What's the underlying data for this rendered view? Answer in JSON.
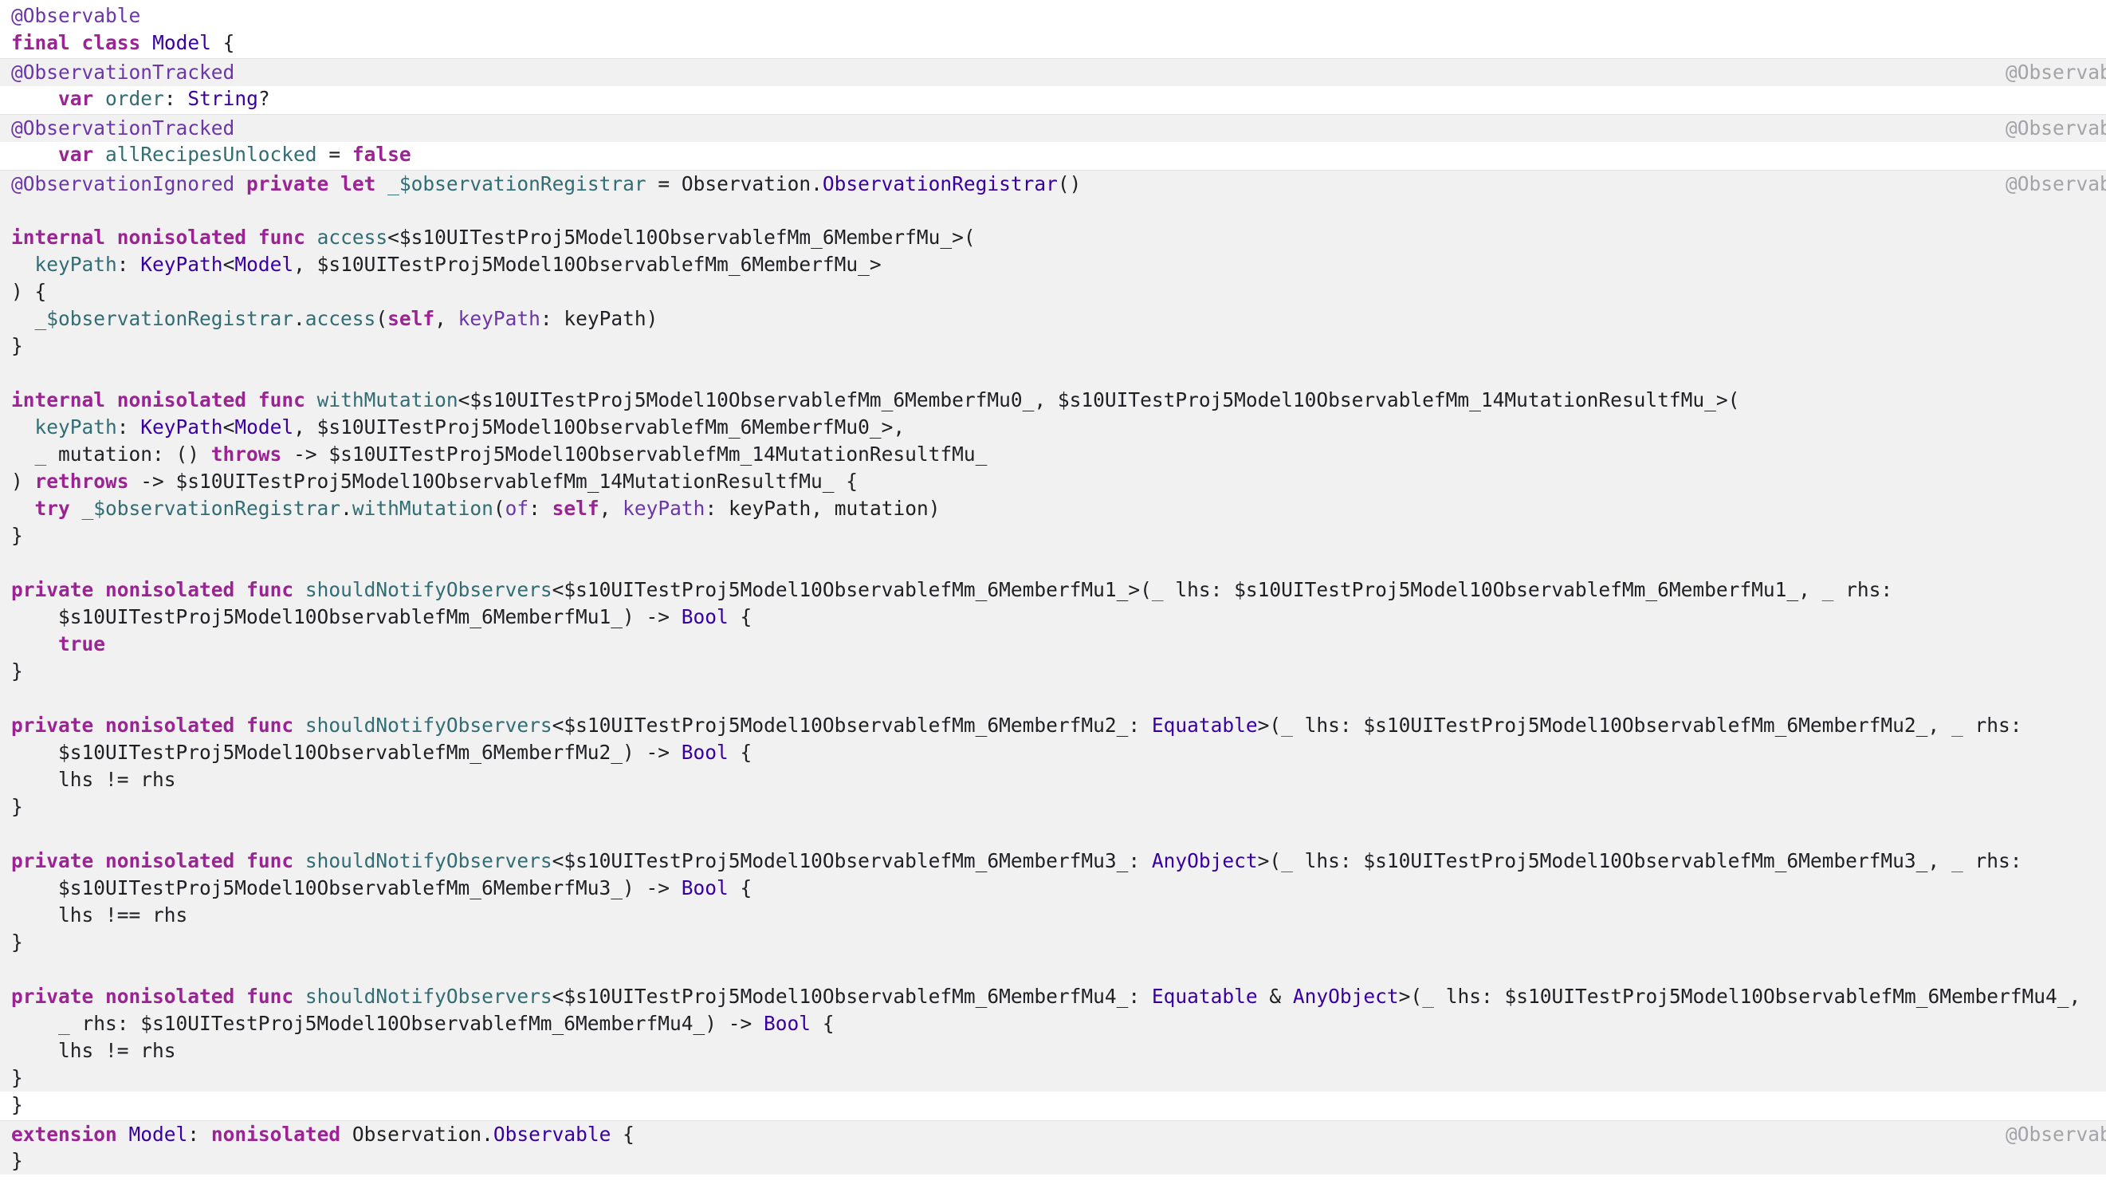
{
  "source_label": "@Observab",
  "colors": {
    "keyword": "#9b2393",
    "type": "#3900a0",
    "function": "#326d74",
    "attribute": "#6c36a9",
    "plain": "#1f1f24",
    "expansion_background": "#f1f1f1",
    "source_label": "#a3a3a8"
  },
  "lines": [
    {
      "kind": "source",
      "tokens": [
        [
          "@Observable",
          "macro"
        ]
      ]
    },
    {
      "kind": "source",
      "tokens": [
        [
          "final",
          "kw"
        ],
        [
          " ",
          ""
        ],
        [
          "class",
          "kw"
        ],
        [
          " ",
          ""
        ],
        [
          "Model",
          "ty"
        ],
        [
          " {",
          ""
        ]
      ]
    },
    {
      "kind": "expansion",
      "label": true,
      "tokens": [
        [
          "@ObservationTracked",
          "macro"
        ]
      ]
    },
    {
      "kind": "source",
      "tokens": [
        [
          "    ",
          ""
        ],
        [
          "var",
          "kw"
        ],
        [
          " ",
          ""
        ],
        [
          "order",
          "fn"
        ],
        [
          ": ",
          ""
        ],
        [
          "String",
          "ty"
        ],
        [
          "?",
          ""
        ]
      ]
    },
    {
      "kind": "expansion",
      "label": true,
      "tokens": [
        [
          "@ObservationTracked",
          "macro"
        ]
      ]
    },
    {
      "kind": "source",
      "tokens": [
        [
          "    ",
          ""
        ],
        [
          "var",
          "kw"
        ],
        [
          " ",
          ""
        ],
        [
          "allRecipesUnlocked",
          "fn"
        ],
        [
          " = ",
          ""
        ],
        [
          "false",
          "kw"
        ]
      ]
    },
    {
      "kind": "expansion",
      "label": true,
      "tokens": [
        [
          "@ObservationIgnored",
          "macro"
        ],
        [
          " ",
          ""
        ],
        [
          "private",
          "kw"
        ],
        [
          " ",
          ""
        ],
        [
          "let",
          "kw"
        ],
        [
          " ",
          ""
        ],
        [
          "_$observationRegistrar",
          "fn"
        ],
        [
          " = Observation.",
          ""
        ],
        [
          "ObservationRegistrar",
          "ty"
        ],
        [
          "()",
          ""
        ]
      ]
    },
    {
      "kind": "expansion",
      "tokens": []
    },
    {
      "kind": "expansion",
      "tokens": [
        [
          "internal",
          "kw"
        ],
        [
          " ",
          ""
        ],
        [
          "nonisolated",
          "kw"
        ],
        [
          " ",
          ""
        ],
        [
          "func",
          "kw"
        ],
        [
          " ",
          ""
        ],
        [
          "access",
          "fn"
        ],
        [
          "<$s10UITestProj5Model10ObservablefMm_6MemberfMu_>(",
          ""
        ]
      ]
    },
    {
      "kind": "expansion",
      "tokens": [
        [
          "  ",
          ""
        ],
        [
          "keyPath",
          "fn"
        ],
        [
          ": ",
          ""
        ],
        [
          "KeyPath",
          "ty"
        ],
        [
          "<",
          ""
        ],
        [
          "Model",
          "ty"
        ],
        [
          ", $s10UITestProj5Model10ObservablefMm_6MemberfMu_>",
          ""
        ]
      ]
    },
    {
      "kind": "expansion",
      "tokens": [
        [
          ") {",
          ""
        ]
      ]
    },
    {
      "kind": "expansion",
      "tokens": [
        [
          "  ",
          ""
        ],
        [
          "_$observationRegistrar",
          "fn"
        ],
        [
          ".",
          ""
        ],
        [
          "access",
          "fn"
        ],
        [
          "(",
          ""
        ],
        [
          "self",
          "kw"
        ],
        [
          ", ",
          ""
        ],
        [
          "keyPath",
          "pp"
        ],
        [
          ": keyPath)",
          ""
        ]
      ]
    },
    {
      "kind": "expansion",
      "tokens": [
        [
          "}",
          ""
        ]
      ]
    },
    {
      "kind": "expansion",
      "tokens": []
    },
    {
      "kind": "expansion",
      "tokens": [
        [
          "internal",
          "kw"
        ],
        [
          " ",
          ""
        ],
        [
          "nonisolated",
          "kw"
        ],
        [
          " ",
          ""
        ],
        [
          "func",
          "kw"
        ],
        [
          " ",
          ""
        ],
        [
          "withMutation",
          "fn"
        ],
        [
          "<$s10UITestProj5Model10ObservablefMm_6MemberfMu0_, $s10UITestProj5Model10ObservablefMm_14MutationResultfMu_>(",
          ""
        ]
      ]
    },
    {
      "kind": "expansion",
      "tokens": [
        [
          "  ",
          ""
        ],
        [
          "keyPath",
          "fn"
        ],
        [
          ": ",
          ""
        ],
        [
          "KeyPath",
          "ty"
        ],
        [
          "<",
          ""
        ],
        [
          "Model",
          "ty"
        ],
        [
          ", $s10UITestProj5Model10ObservablefMm_6MemberfMu0_>,",
          ""
        ]
      ]
    },
    {
      "kind": "expansion",
      "tokens": [
        [
          "  ",
          ""
        ],
        [
          "_",
          "fn"
        ],
        [
          " mutation: () ",
          ""
        ],
        [
          "throws",
          "kw"
        ],
        [
          " -> $s10UITestProj5Model10ObservablefMm_14MutationResultfMu_",
          ""
        ]
      ]
    },
    {
      "kind": "expansion",
      "tokens": [
        [
          ") ",
          ""
        ],
        [
          "rethrows",
          "kw"
        ],
        [
          " -> $s10UITestProj5Model10ObservablefMm_14MutationResultfMu_ {",
          ""
        ]
      ]
    },
    {
      "kind": "expansion",
      "tokens": [
        [
          "  ",
          ""
        ],
        [
          "try",
          "kw"
        ],
        [
          " ",
          ""
        ],
        [
          "_$observationRegistrar",
          "fn"
        ],
        [
          ".",
          ""
        ],
        [
          "withMutation",
          "fn"
        ],
        [
          "(",
          ""
        ],
        [
          "of",
          "pp"
        ],
        [
          ": ",
          ""
        ],
        [
          "self",
          "kw"
        ],
        [
          ", ",
          ""
        ],
        [
          "keyPath",
          "pp"
        ],
        [
          ": keyPath, mutation)",
          ""
        ]
      ]
    },
    {
      "kind": "expansion",
      "tokens": [
        [
          "}",
          ""
        ]
      ]
    },
    {
      "kind": "expansion",
      "tokens": []
    },
    {
      "kind": "expansion",
      "tokens": [
        [
          "private",
          "kw"
        ],
        [
          " ",
          ""
        ],
        [
          "nonisolated",
          "kw"
        ],
        [
          " ",
          ""
        ],
        [
          "func",
          "kw"
        ],
        [
          " ",
          ""
        ],
        [
          "shouldNotifyObservers",
          "fn"
        ],
        [
          "<$s10UITestProj5Model10ObservablefMm_6MemberfMu1_>(",
          ""
        ],
        [
          "_",
          "fn"
        ],
        [
          " lhs: $s10UITestProj5Model10ObservablefMm_6MemberfMu1_, ",
          ""
        ],
        [
          "_",
          "fn"
        ],
        [
          " rhs:",
          ""
        ]
      ]
    },
    {
      "kind": "expansion",
      "tokens": [
        [
          "    $s10UITestProj5Model10ObservablefMm_6MemberfMu1_) -> ",
          ""
        ],
        [
          "Bool",
          "ty"
        ],
        [
          " {",
          ""
        ]
      ]
    },
    {
      "kind": "expansion",
      "tokens": [
        [
          "    ",
          ""
        ],
        [
          "true",
          "kw"
        ]
      ]
    },
    {
      "kind": "expansion",
      "tokens": [
        [
          "}",
          ""
        ]
      ]
    },
    {
      "kind": "expansion",
      "tokens": []
    },
    {
      "kind": "expansion",
      "tokens": [
        [
          "private",
          "kw"
        ],
        [
          " ",
          ""
        ],
        [
          "nonisolated",
          "kw"
        ],
        [
          " ",
          ""
        ],
        [
          "func",
          "kw"
        ],
        [
          " ",
          ""
        ],
        [
          "shouldNotifyObservers",
          "fn"
        ],
        [
          "<$s10UITestProj5Model10ObservablefMm_6MemberfMu2_: ",
          ""
        ],
        [
          "Equatable",
          "ty"
        ],
        [
          ">(",
          ""
        ],
        [
          "_",
          "fn"
        ],
        [
          " lhs: $s10UITestProj5Model10ObservablefMm_6MemberfMu2_, ",
          ""
        ],
        [
          "_",
          "fn"
        ],
        [
          " rhs:",
          ""
        ]
      ]
    },
    {
      "kind": "expansion",
      "tokens": [
        [
          "    $s10UITestProj5Model10ObservablefMm_6MemberfMu2_) -> ",
          ""
        ],
        [
          "Bool",
          "ty"
        ],
        [
          " {",
          ""
        ]
      ]
    },
    {
      "kind": "expansion",
      "tokens": [
        [
          "    lhs != rhs",
          ""
        ]
      ]
    },
    {
      "kind": "expansion",
      "tokens": [
        [
          "}",
          ""
        ]
      ]
    },
    {
      "kind": "expansion",
      "tokens": []
    },
    {
      "kind": "expansion",
      "tokens": [
        [
          "private",
          "kw"
        ],
        [
          " ",
          ""
        ],
        [
          "nonisolated",
          "kw"
        ],
        [
          " ",
          ""
        ],
        [
          "func",
          "kw"
        ],
        [
          " ",
          ""
        ],
        [
          "shouldNotifyObservers",
          "fn"
        ],
        [
          "<$s10UITestProj5Model10ObservablefMm_6MemberfMu3_: ",
          ""
        ],
        [
          "AnyObject",
          "ty"
        ],
        [
          ">(",
          ""
        ],
        [
          "_",
          "fn"
        ],
        [
          " lhs: $s10UITestProj5Model10ObservablefMm_6MemberfMu3_, ",
          ""
        ],
        [
          "_",
          "fn"
        ],
        [
          " rhs:",
          ""
        ]
      ]
    },
    {
      "kind": "expansion",
      "tokens": [
        [
          "    $s10UITestProj5Model10ObservablefMm_6MemberfMu3_) -> ",
          ""
        ],
        [
          "Bool",
          "ty"
        ],
        [
          " {",
          ""
        ]
      ]
    },
    {
      "kind": "expansion",
      "tokens": [
        [
          "    lhs !== rhs",
          ""
        ]
      ]
    },
    {
      "kind": "expansion",
      "tokens": [
        [
          "}",
          ""
        ]
      ]
    },
    {
      "kind": "expansion",
      "tokens": []
    },
    {
      "kind": "expansion",
      "tokens": [
        [
          "private",
          "kw"
        ],
        [
          " ",
          ""
        ],
        [
          "nonisolated",
          "kw"
        ],
        [
          " ",
          ""
        ],
        [
          "func",
          "kw"
        ],
        [
          " ",
          ""
        ],
        [
          "shouldNotifyObservers",
          "fn"
        ],
        [
          "<$s10UITestProj5Model10ObservablefMm_6MemberfMu4_: ",
          ""
        ],
        [
          "Equatable",
          "ty"
        ],
        [
          " & ",
          ""
        ],
        [
          "AnyObject",
          "ty"
        ],
        [
          ">(",
          ""
        ],
        [
          "_",
          "fn"
        ],
        [
          " lhs: $s10UITestProj5Model10ObservablefMm_6MemberfMu4_,",
          ""
        ]
      ]
    },
    {
      "kind": "expansion",
      "tokens": [
        [
          "    ",
          ""
        ],
        [
          "_",
          "fn"
        ],
        [
          " rhs: $s10UITestProj5Model10ObservablefMm_6MemberfMu4_) -> ",
          ""
        ],
        [
          "Bool",
          "ty"
        ],
        [
          " {",
          ""
        ]
      ]
    },
    {
      "kind": "expansion",
      "tokens": [
        [
          "    lhs != rhs",
          ""
        ]
      ]
    },
    {
      "kind": "expansion",
      "tokens": [
        [
          "}",
          ""
        ]
      ]
    },
    {
      "kind": "source",
      "tokens": [
        [
          "}",
          ""
        ]
      ]
    },
    {
      "kind": "expansion",
      "label": true,
      "tokens": [
        [
          "extension",
          "kw"
        ],
        [
          " ",
          ""
        ],
        [
          "Model",
          "ty"
        ],
        [
          ": ",
          ""
        ],
        [
          "nonisolated",
          "kw"
        ],
        [
          " Observation.",
          ""
        ],
        [
          "Observable",
          "ty"
        ],
        [
          " {",
          ""
        ]
      ]
    },
    {
      "kind": "expansion",
      "tokens": [
        [
          "}",
          ""
        ]
      ]
    }
  ]
}
